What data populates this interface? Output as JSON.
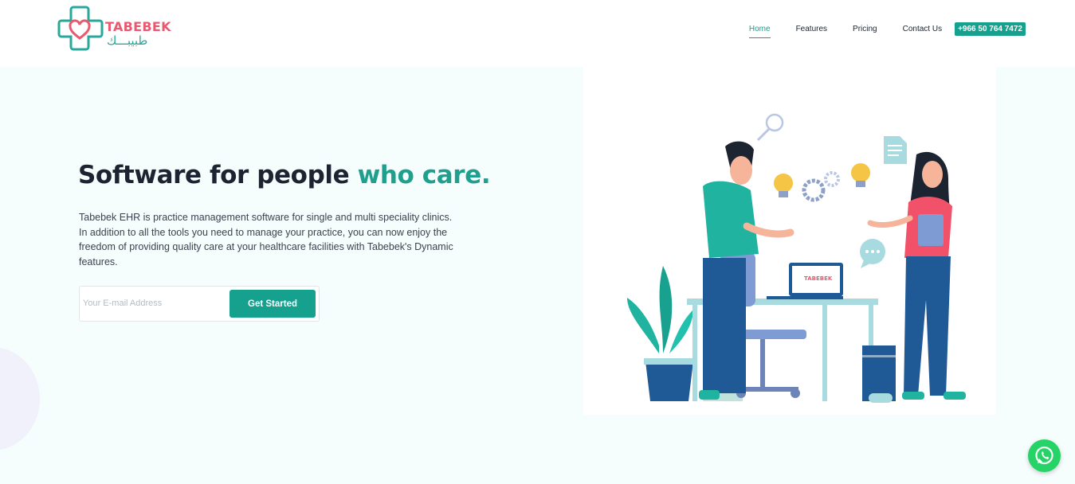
{
  "brand": {
    "name_en": "TABEBEK",
    "name_ar": "طبيبـــك",
    "primary_color": "#16a08e",
    "logo_pink": "#e85a70"
  },
  "nav": {
    "items": [
      {
        "label": "Home",
        "active": true
      },
      {
        "label": "Features"
      },
      {
        "label": "Pricing"
      },
      {
        "label": "Contact Us"
      }
    ],
    "phone": "+966 50 764 7472"
  },
  "hero": {
    "headline_main": "Software for people ",
    "headline_accent": "who care.",
    "description": "Tabebek EHR is practice management software for single and multi speciality clinics. In addition to all the tools you need to manage your practice, you can now enjoy the freedom of providing quality care at your healthcare facilities with Tabebek's Dynamic features.",
    "email_placeholder": "Your E-mail Address",
    "cta_label": "Get Started"
  },
  "illustration": {
    "laptop_logo": "TABEBEK"
  },
  "icons": [
    "logo-cross-heart-icon",
    "whatsapp-icon",
    "magnifier-icon",
    "lightbulb-icon",
    "gear-icon",
    "document-icon",
    "chat-bubble-icon"
  ]
}
